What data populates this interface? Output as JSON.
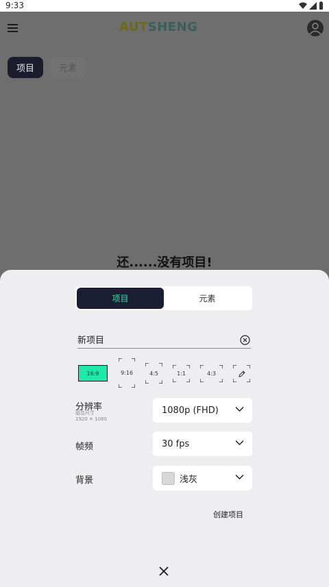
{
  "status": {
    "time": "9:33"
  },
  "header": {
    "logo_part1": "AUT",
    "logo_part2": "SHENG",
    "menu_icon": "hamburger-menu-icon",
    "avatar_icon": "user-avatar-icon"
  },
  "main_tabs": [
    {
      "label": "项目",
      "active": true
    },
    {
      "label": "元素",
      "active": false
    }
  ],
  "empty_state": {
    "message": "还......没有项目!"
  },
  "sheet": {
    "segments": [
      {
        "label": "项目",
        "active": true
      },
      {
        "label": "元素",
        "active": false
      }
    ],
    "name_input": {
      "value": "新项目",
      "clear_icon": "clear-circle-icon"
    },
    "aspect_ratios": [
      {
        "label": "16:9",
        "selected": true
      },
      {
        "label": "9:16",
        "selected": false
      },
      {
        "label": "4:5",
        "selected": false
      },
      {
        "label": "1:1",
        "selected": false
      },
      {
        "label": "4:3",
        "selected": false
      },
      {
        "label": "",
        "icon": "pencil-edit-icon",
        "selected": false
      }
    ],
    "resolution": {
      "label": "分辨率",
      "sublabel_1": "组合尺寸",
      "sublabel_2": "1920 ✕ 1080",
      "value": "1080p (FHD)"
    },
    "framerate": {
      "label": "帧频",
      "value": "30 fps"
    },
    "background": {
      "label": "背景",
      "value": "浅灰",
      "swatch_color": "#d8d8d8"
    },
    "create_label": "创建项目",
    "close_icon": "close-x-icon"
  },
  "colors": {
    "accent": "#1fe8a8",
    "dark_navy": "#1c1f33",
    "sheet_bg": "#eeeef0"
  }
}
